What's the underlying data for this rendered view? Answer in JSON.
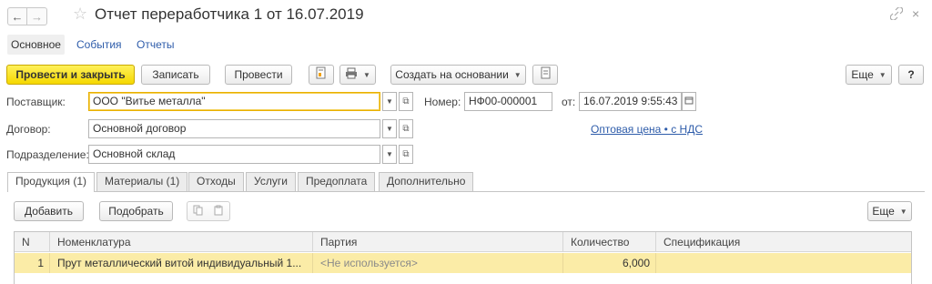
{
  "window": {
    "title": "Отчет переработчика 1 от 16.07.2019"
  },
  "section_tabs": {
    "main": "Основное",
    "events": "События",
    "reports": "Отчеты"
  },
  "toolbar": {
    "post_close": "Провести и закрыть",
    "save": "Записать",
    "post": "Провести",
    "create_based": "Создать на основании",
    "more": "Еще",
    "help": "?"
  },
  "form": {
    "supplier_label": "Поставщик:",
    "supplier_value": "ООО \"Витье металла\"",
    "number_label": "Номер:",
    "number_value": "НФ00-000001",
    "date_label": "от:",
    "date_value": "16.07.2019  9:55:43",
    "contract_label": "Договор:",
    "contract_value": "Основной договор",
    "price_link": "Оптовая цена • с НДС",
    "division_label": "Подразделение:",
    "division_value": "Основной склад"
  },
  "page_tabs": [
    {
      "label": "Продукция (1)"
    },
    {
      "label": "Материалы (1)"
    },
    {
      "label": "Отходы"
    },
    {
      "label": "Услуги"
    },
    {
      "label": "Предоплата"
    },
    {
      "label": "Дополнительно"
    }
  ],
  "table_toolbar": {
    "add": "Добавить",
    "pick": "Подобрать",
    "more": "Еще"
  },
  "table": {
    "columns": [
      "N",
      "Номенклатура",
      "Партия",
      "Количество",
      "Спецификация"
    ],
    "rows": [
      {
        "n": "1",
        "item": "Прут металлический витой индивидуальный 1...",
        "batch": "<Не используется>",
        "qty": "6,000",
        "spec": ""
      }
    ]
  },
  "colors": {
    "primary_button": "#f5d800",
    "link": "#2e5caa",
    "selected_row": "#fbeca7",
    "focused_border": "#e9b000"
  }
}
